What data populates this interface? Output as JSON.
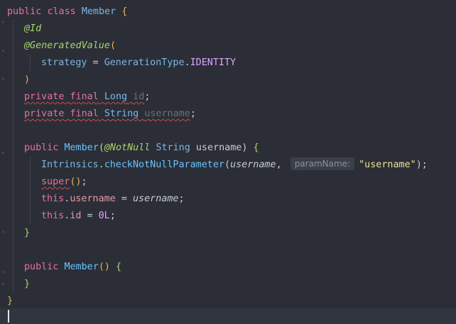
{
  "editor": {
    "language": "java",
    "colors": {
      "background": "#2b2e36",
      "keyword": "#e5739b",
      "class": "#7ab7e6",
      "annotation": "#a8d46f",
      "string": "#f0e291"
    },
    "tokens": {
      "public": "public",
      "class": "class",
      "member": "Member",
      "id_ann": "@Id",
      "gen_value": "@GeneratedValue",
      "strategy": "strategy",
      "gen_type": "GenerationType",
      "identity": "IDENTITY",
      "private": "private",
      "final": "final",
      "long_t": "Long",
      "string_t": "String",
      "id": "id",
      "username": "username",
      "not_null": "@NotNull",
      "intrinsics": "Intrinsics",
      "check": "checkNotNullParameter",
      "param_hint": "paramName:",
      "str_username": "\"username\"",
      "super": "super",
      "this": "this",
      "zero_l": "0L"
    }
  }
}
